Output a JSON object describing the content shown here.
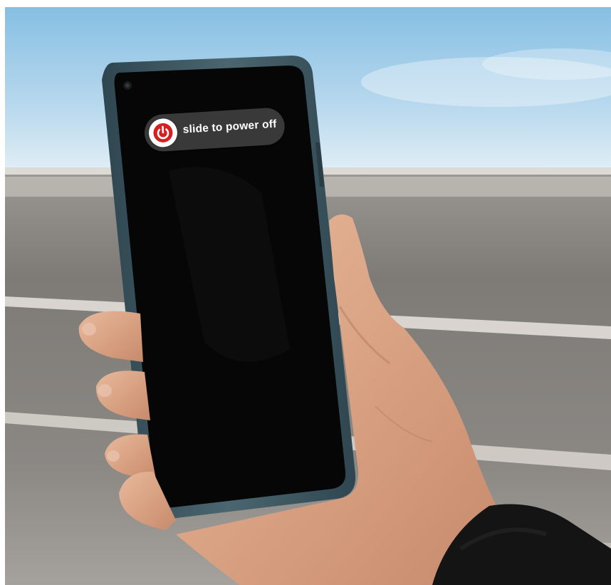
{
  "scene": {
    "description_colors": {
      "sky_top": "#86bfe3",
      "sky_bottom": "#dfeef6",
      "tarmac": "#7d7b78",
      "phone_frame": "#3f5963",
      "screen": "#070707",
      "skin": "#d9a88a",
      "sleeve": "#151515"
    }
  },
  "power_slider": {
    "label": "slide to power off",
    "icon": "power-icon",
    "pill_color": "#3e3e3e",
    "knob_color": "#ffffff",
    "icon_color": "#d42020"
  }
}
